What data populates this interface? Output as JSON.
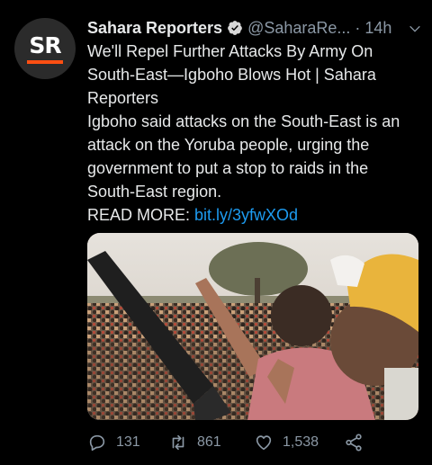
{
  "tweet": {
    "avatar_text": "SR",
    "display_name": "Sahara Reporters",
    "handle": "@SaharaRe...",
    "separator": "·",
    "time": "14h",
    "headline": "We'll Repel Further Attacks By Army On South-East—Igboho Blows Hot | Sahara Reporters",
    "summary": "Igboho said attacks on the South-East is an attack on the Yoruba people, urging the government to put a stop to raids in the South-East region.",
    "read_more_label": "READ MORE:",
    "link_text": "bit.ly/3yfwXOd"
  },
  "actions": {
    "replies": "131",
    "retweets": "861",
    "likes": "1,538"
  },
  "icons": {
    "verified": "verified-badge-icon",
    "menu": "chevron-down-icon",
    "reply": "reply-icon",
    "retweet": "retweet-icon",
    "like": "heart-icon",
    "share": "share-icon"
  },
  "colors": {
    "background": "#000000",
    "text": "#e7e9ea",
    "secondary": "#8b98a5",
    "link": "#1d9bf0",
    "brand_bar": "#ff4f12"
  }
}
